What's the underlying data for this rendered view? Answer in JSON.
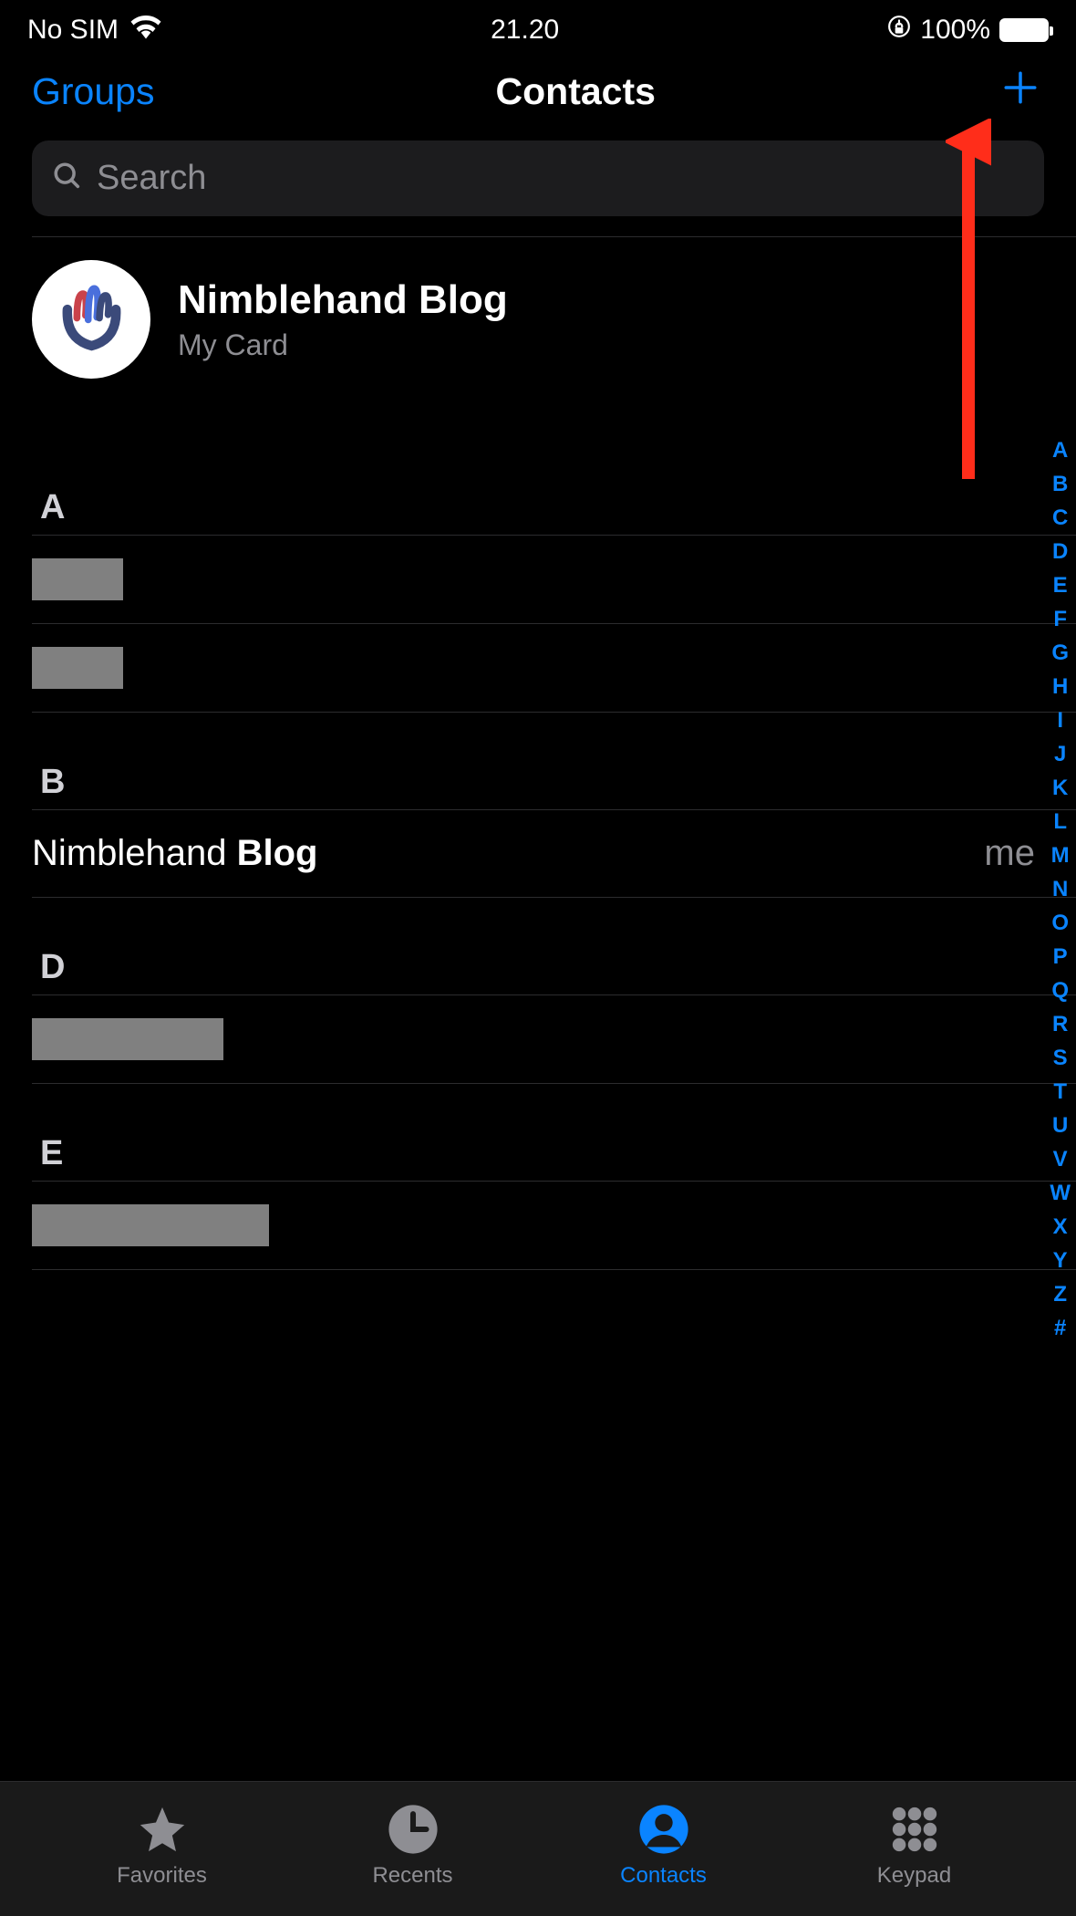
{
  "status_bar": {
    "carrier": "No SIM",
    "time": "21.20",
    "battery_percent": "100%"
  },
  "nav": {
    "left": "Groups",
    "title": "Contacts",
    "add_icon": "plus-icon"
  },
  "search": {
    "placeholder": "Search"
  },
  "my_card": {
    "name": "Nimblehand Blog",
    "sub": "My Card"
  },
  "sections": [
    {
      "letter": "A",
      "items": [
        {
          "redacted": true,
          "width": "w1"
        },
        {
          "redacted": true,
          "width": "w1"
        }
      ]
    },
    {
      "letter": "B",
      "items": [
        {
          "first": "Nimblehand",
          "last": "Blog",
          "me": true
        }
      ]
    },
    {
      "letter": "D",
      "items": [
        {
          "redacted": true,
          "width": "w2"
        }
      ]
    },
    {
      "letter": "E",
      "items": [
        {
          "redacted": true,
          "width": "w3"
        }
      ]
    }
  ],
  "me_label": "me",
  "index_letters": [
    "A",
    "B",
    "C",
    "D",
    "E",
    "F",
    "G",
    "H",
    "I",
    "J",
    "K",
    "L",
    "M",
    "N",
    "O",
    "P",
    "Q",
    "R",
    "S",
    "T",
    "U",
    "V",
    "W",
    "X",
    "Y",
    "Z",
    "#"
  ],
  "tabs": [
    {
      "id": "favorites",
      "label": "Favorites",
      "active": false
    },
    {
      "id": "recents",
      "label": "Recents",
      "active": false
    },
    {
      "id": "contacts",
      "label": "Contacts",
      "active": true
    },
    {
      "id": "keypad",
      "label": "Keypad",
      "active": false
    }
  ],
  "colors": {
    "accent": "#0a84ff",
    "muted": "#8e8e93",
    "annotation": "#ff3b30"
  }
}
